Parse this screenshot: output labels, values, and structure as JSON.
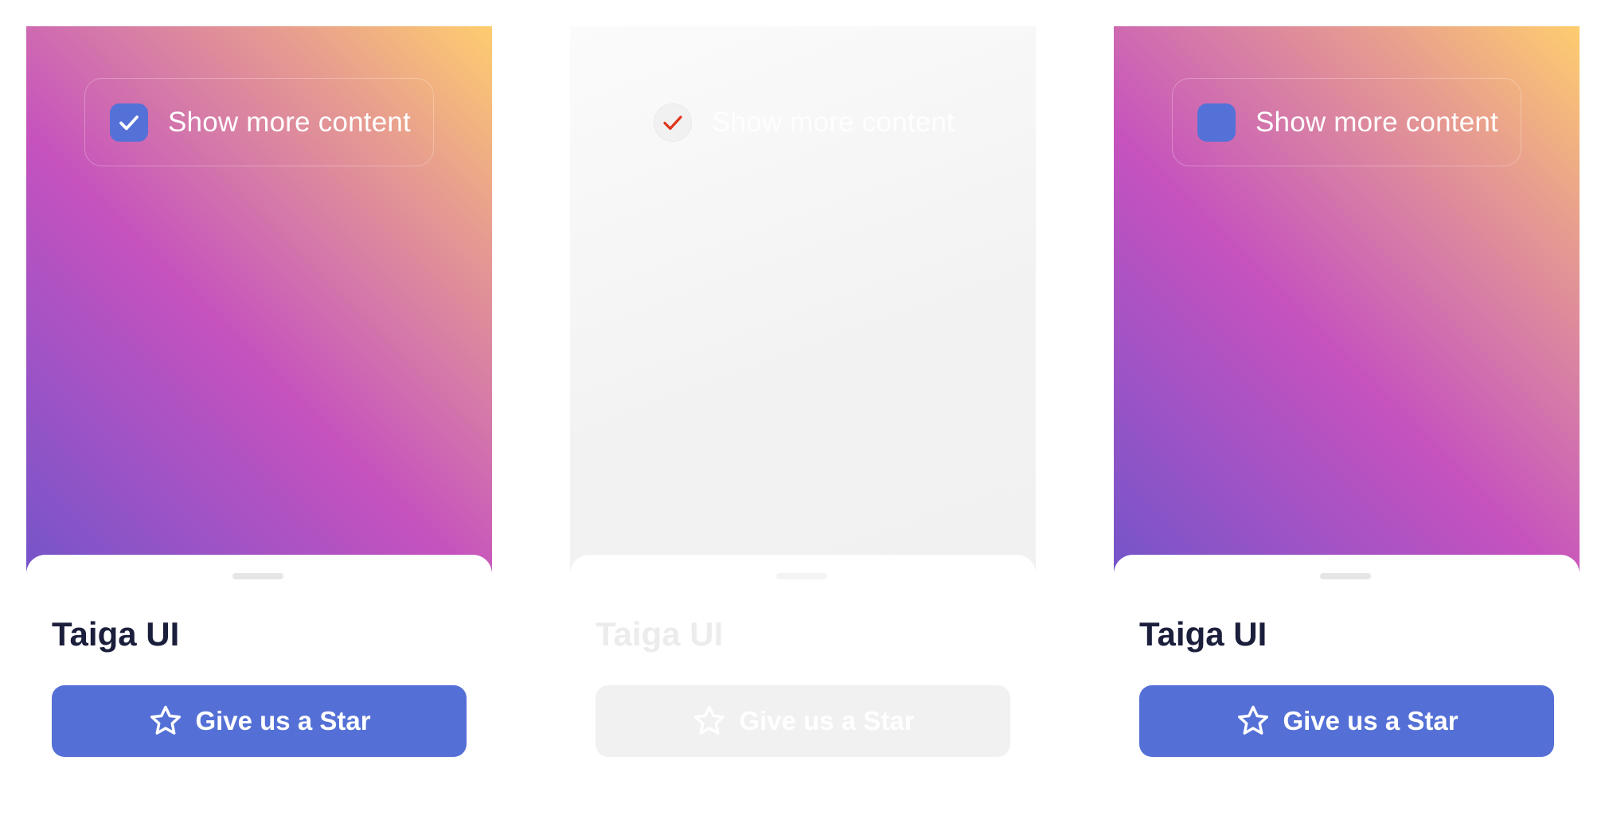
{
  "frames": [
    {
      "state": "checked",
      "checkbox_label": "Show more content",
      "title": "Taiga UI",
      "button_label": "Give us a Star",
      "icons": {
        "checkbox": "check-icon",
        "button": "star-icon"
      }
    },
    {
      "state": "disabled",
      "checkbox_label": "Show more content",
      "title": "Taiga UI",
      "button_label": "Give us a Star",
      "icons": {
        "checkbox": "check-icon",
        "button": "star-icon"
      }
    },
    {
      "state": "unchecked",
      "checkbox_label": "Show more content",
      "title": "Taiga UI",
      "button_label": "Give us a Star",
      "icons": {
        "checkbox": "none",
        "button": "star-icon"
      }
    }
  ],
  "colors": {
    "primary": "#5470d6",
    "title": "#1b1f3b",
    "gradient_start": "#fecd6f",
    "gradient_mid": "#c652be",
    "gradient_end": "#7254c9",
    "disabled_bg": "#f1f1f1",
    "disabled_check": "#ff7043"
  }
}
